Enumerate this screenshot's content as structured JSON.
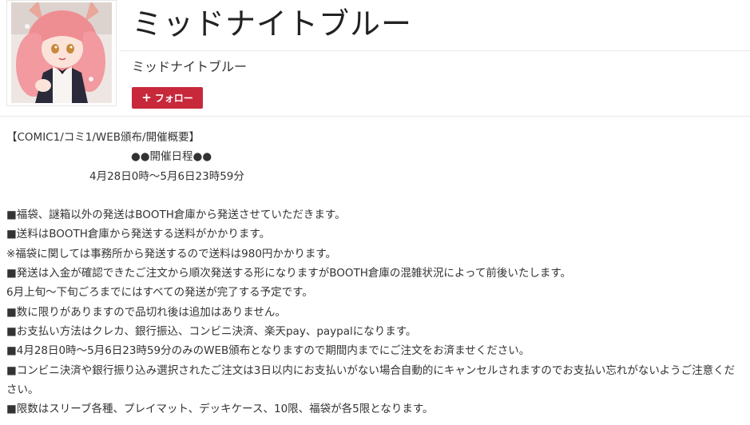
{
  "shop": {
    "title": "ミッドナイトブルー",
    "subname": "ミッドナイトブルー",
    "follow_label": "フォロー",
    "follow_icon": "plus-icon"
  },
  "colors": {
    "follow_bg": "#c7283a",
    "text": "#333333",
    "divider": "#e8e8e8"
  },
  "description": {
    "heading": "【COMIC1/コミ1/WEB頒布/開催概要】",
    "schedule_title": "●●開催日程●●",
    "schedule_range": "4月28日0時～5月6日23時59分",
    "lines": [
      "■福袋、謎箱以外の発送はBOOTH倉庫から発送させていただきます。",
      "■送料はBOOTH倉庫から発送する送料がかかります。",
      "※福袋に関しては事務所から発送するので送料は980円かかります。",
      "■発送は入金が確認できたご注文から順次発送する形になりますがBOOTH倉庫の混雑状況によって前後いたします。",
      "6月上旬～下旬ごろまでにはすべての発送が完了する予定です。",
      "■数に限りがありますので品切れ後は追加はありません。",
      "■お支払い方法はクレカ、銀行振込、コンビニ決済、楽天pay、paypalになります。",
      "■4月28日0時～5月6日23時59分のみのWEB頒布となりますので期間内までにご注文をお済ませください。",
      "■コンビニ決済や銀行振り込み選択されたご注文は3日以内にお支払いがない場合自動的にキャンセルされますのでお支払い忘れがないようご注意ください。",
      "■限数はスリーブ各種、プレイマット、デッキケース、10限、福袋が各5限となります。"
    ]
  }
}
